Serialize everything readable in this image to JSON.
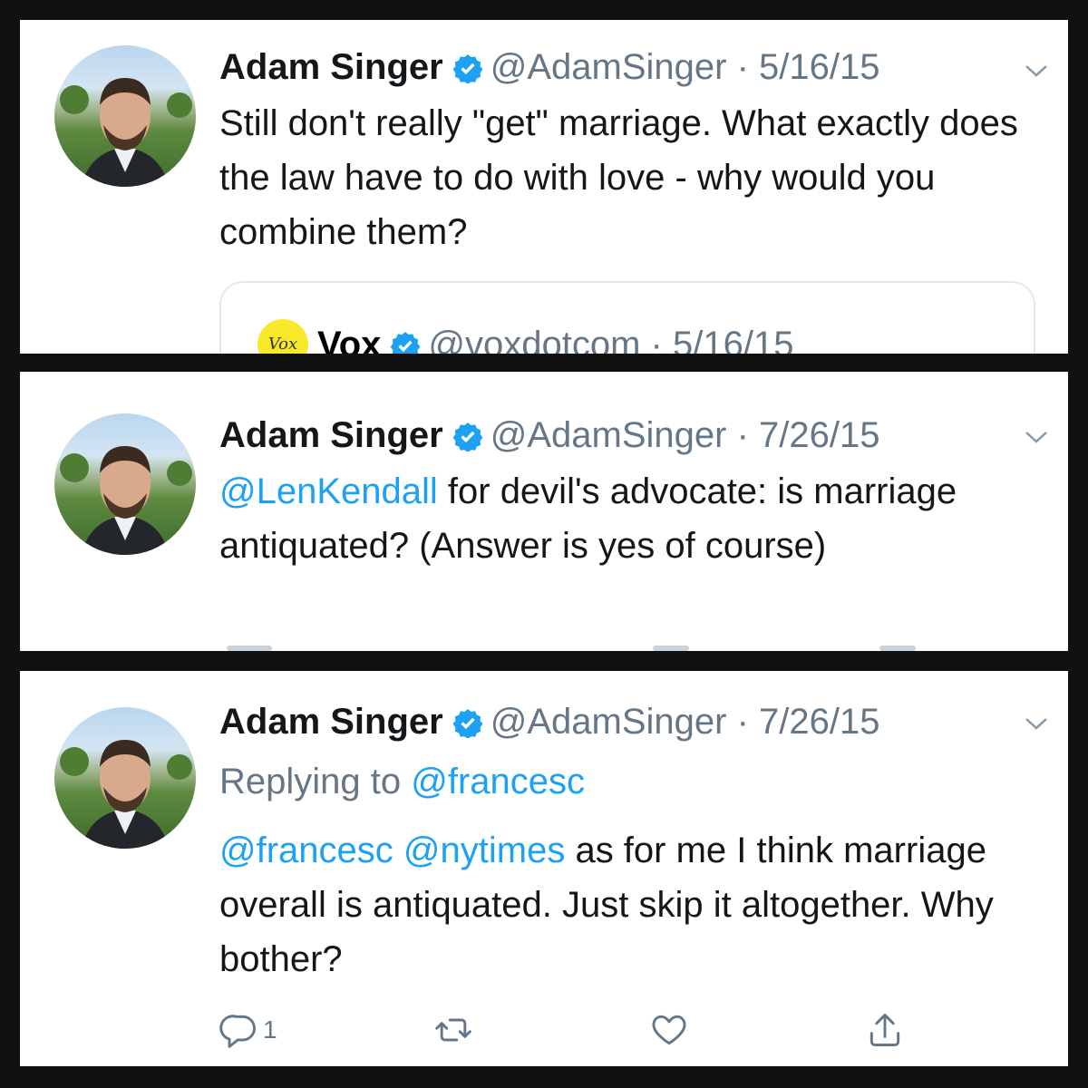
{
  "colors": {
    "link": "#1da1f2",
    "muted": "#657786",
    "text": "#14171a",
    "verified": "#1da1f2",
    "background": "#111111",
    "vox_logo": "#f7e92a"
  },
  "tweets": [
    {
      "author_name": "Adam Singer",
      "handle": "@AdamSinger",
      "separator": "·",
      "date": "5/16/15",
      "text": "Still don't really \"get\" marriage. What exactly does the law have to do with love - why would you combine them?",
      "quoted": {
        "logo_text": "Vox",
        "author_name": "Vox",
        "handle": "@voxdotcom",
        "separator": "·",
        "date": "5/16/15"
      }
    },
    {
      "author_name": "Adam Singer",
      "handle": "@AdamSinger",
      "separator": "·",
      "date": "7/26/15",
      "mention": "@LenKendall",
      "text": " for devil's advocate: is marriage antiquated? (Answer is yes of course)"
    },
    {
      "author_name": "Adam Singer",
      "handle": "@AdamSinger",
      "separator": "·",
      "date": "7/26/15",
      "replying_prefix": "Replying to ",
      "replying_to": "@francesc",
      "mention1": "@francesc",
      "mention2": "@nytimes",
      "text": " as for me I think marriage overall is antiquated. Just skip it altogether. Why bother?",
      "actions": {
        "reply_count": "1",
        "icons": [
          "reply-icon",
          "retweet-icon",
          "like-icon",
          "share-icon"
        ]
      }
    }
  ]
}
